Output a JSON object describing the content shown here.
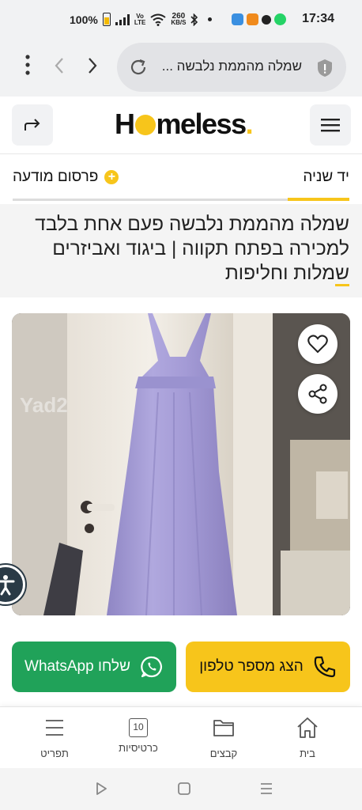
{
  "status_bar": {
    "battery": "100%",
    "network_small": [
      "Vo",
      "LTE"
    ],
    "speed": [
      "260",
      "KB/S"
    ],
    "time": "17:34"
  },
  "browser": {
    "url_text": "שמלה מהממת נלבשה ..."
  },
  "site": {
    "logo_parts": [
      "H",
      "meless",
      "."
    ],
    "subnav_right": "יד שניה",
    "subnav_left": "פרסום מודעה",
    "title_main": "שמלה מהממת נלבשה פעם אחת בלבד למכירה בפתח תקווה | ביגוד ואביזרים ",
    "title_highlight": "ש",
    "title_end": "מלות וחליפות"
  },
  "photo": {
    "watermark": "Yad2"
  },
  "actions": {
    "phone_label": "הצג מספר טלפון",
    "whatsapp_label": "שלחו WhatsApp"
  },
  "bottom_nav": {
    "home": "בית",
    "files": "קבצים",
    "cards": "כרטיסיות",
    "cards_count": "10",
    "menu": "תפריט"
  },
  "colors": {
    "accent": "#f7c51b",
    "whatsapp": "#20a259"
  }
}
